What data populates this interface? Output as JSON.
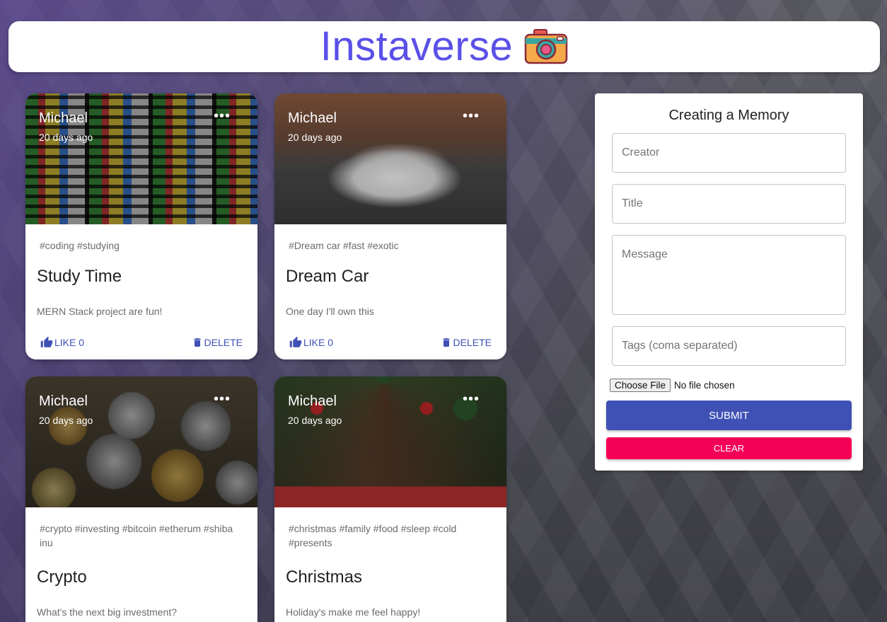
{
  "app": {
    "title": "Instaverse"
  },
  "colors": {
    "accent": "#5a50e8",
    "primary": "#3f51b5",
    "secondary": "#f50057"
  },
  "posts": [
    {
      "author": "Michael",
      "time": "20 days ago",
      "tags": "#coding #studying",
      "title": "Study Time",
      "message": "MERN Stack project are fun!",
      "like_label": "LIKE 0",
      "delete_label": "DELETE",
      "image": "code-screen-image"
    },
    {
      "author": "Michael",
      "time": "20 days ago",
      "tags": "#Dream car #fast #exotic",
      "title": "Dream Car",
      "message": "One day I'll own this",
      "like_label": "LIKE 0",
      "delete_label": "DELETE",
      "image": "white-sports-car-image"
    },
    {
      "author": "Michael",
      "time": "20 days ago",
      "tags": "#crypto #investing #bitcoin #etherum #shiba inu",
      "title": "Crypto",
      "message": "What's the next big investment?",
      "image": "crypto-coins-image"
    },
    {
      "author": "Michael",
      "time": "20 days ago",
      "tags": "#christmas #family #food #sleep #cold #presents",
      "title": "Christmas",
      "message": "Holiday's make me feel happy!",
      "image": "christmas-tree-image"
    }
  ],
  "form": {
    "title": "Creating a Memory",
    "creator_placeholder": "Creator",
    "title_placeholder": "Title",
    "message_placeholder": "Message",
    "tags_placeholder": "Tags (coma separated)",
    "file_button": "Choose File",
    "file_status": "No file chosen",
    "submit_label": "SUBMIT",
    "clear_label": "CLEAR"
  }
}
